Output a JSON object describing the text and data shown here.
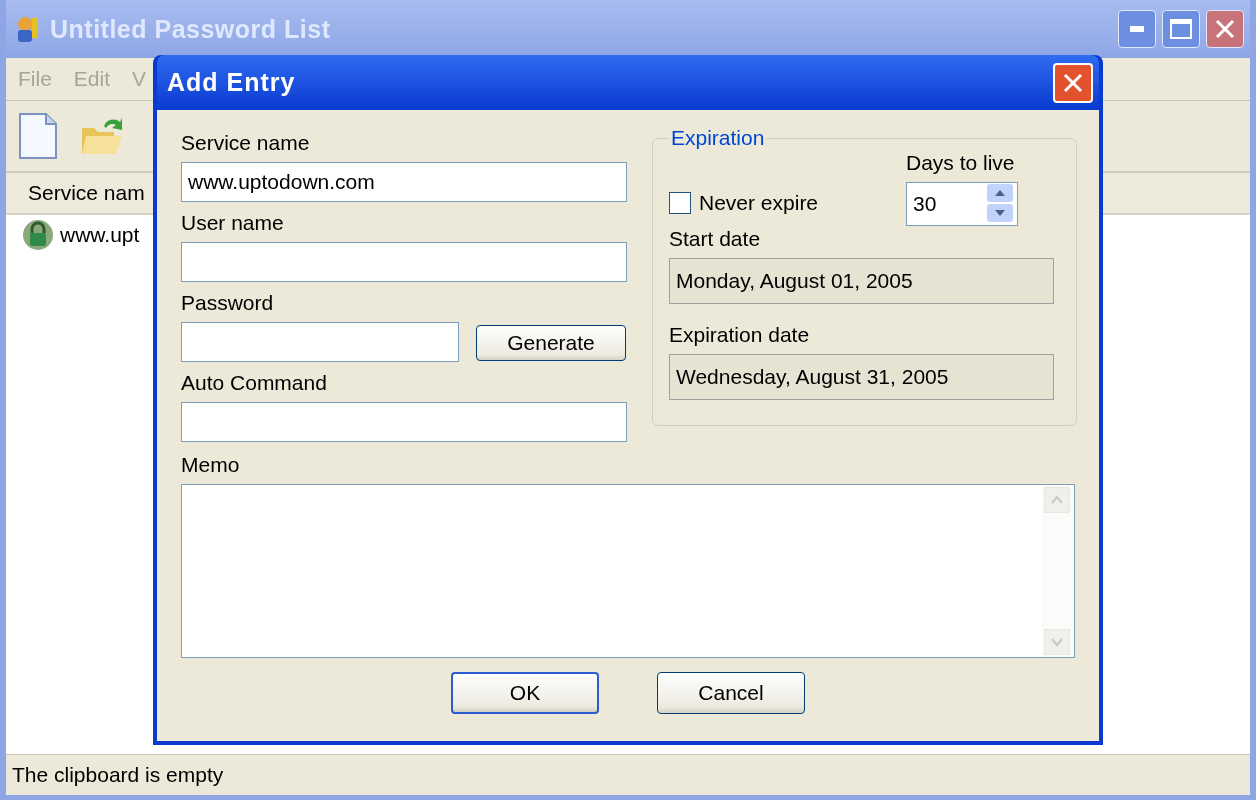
{
  "window": {
    "title": "Untitled Password List"
  },
  "menu": [
    {
      "label": "File"
    },
    {
      "label": "Edit"
    },
    {
      "label": "V"
    }
  ],
  "list": {
    "columns": [
      "Service nam"
    ],
    "rows": [
      {
        "service": "www.upt"
      }
    ]
  },
  "dialog": {
    "title": "Add Entry",
    "fields": [
      {
        "label": "Service name",
        "value": "www.uptodown.com"
      },
      {
        "label": "User name"
      },
      {
        "label": "Password",
        "button": "Generate"
      },
      {
        "label": "Auto Command"
      }
    ],
    "expiration": {
      "legend": "Expiration",
      "never_expire": {
        "label": "Never expire",
        "checked": false
      },
      "days": {
        "label": "Days to live",
        "value": "30"
      },
      "start": {
        "label": "Start date",
        "value": "Monday, August 01, 2005"
      },
      "end": {
        "label": "Expiration date",
        "value": "Wednesday, August 31, 2005"
      }
    },
    "memo": {
      "label": "Memo"
    },
    "buttons": [
      {
        "label": "OK",
        "default": true
      },
      {
        "label": "Cancel",
        "default": false
      }
    ]
  },
  "status_bar": {
    "text": "The clipboard is empty"
  }
}
